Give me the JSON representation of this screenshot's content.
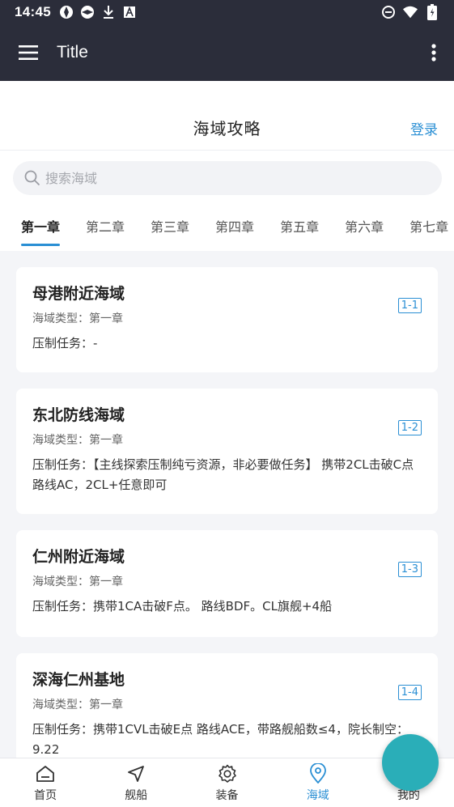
{
  "status_bar": {
    "time": "14:45"
  },
  "app_bar": {
    "title": "Title"
  },
  "page": {
    "title": "海域攻略",
    "login": "登录"
  },
  "search": {
    "placeholder": "搜索海域"
  },
  "tabs": [
    "第一章",
    "第二章",
    "第三章",
    "第四章",
    "第五章",
    "第六章",
    "第七章"
  ],
  "active_tab": 0,
  "cards": [
    {
      "title": "母港附近海域",
      "type": "海域类型：第一章",
      "task": "压制任务：-",
      "badge": "1-1"
    },
    {
      "title": "东北防线海域",
      "type": "海域类型：第一章",
      "task": "压制任务：【主线探索压制纯亏资源，非必要做任务】 携带2CL击破C点 路线AC，2CL+任意即可",
      "badge": "1-2"
    },
    {
      "title": "仁州附近海域",
      "type": "海域类型：第一章",
      "task": "压制任务：携带1CA击破F点。 路线BDF。CL旗舰+4船",
      "badge": "1-3"
    },
    {
      "title": "深海仁州基地",
      "type": "海域类型：第一章",
      "task": "压制任务：携带1CVL击破E点 路线ACE，带路舰船数≤4，院长制空：9.22",
      "badge": "1-4"
    }
  ],
  "bottom_nav": [
    {
      "label": "首页",
      "icon": "home-icon"
    },
    {
      "label": "舰船",
      "icon": "navigation-arrow-icon"
    },
    {
      "label": "装备",
      "icon": "gear-icon"
    },
    {
      "label": "海域",
      "icon": "location-pin-icon"
    },
    {
      "label": "我的",
      "icon": "user-icon"
    }
  ],
  "accent_color": "#2a8fd4",
  "fab_color": "#2aaeb8"
}
